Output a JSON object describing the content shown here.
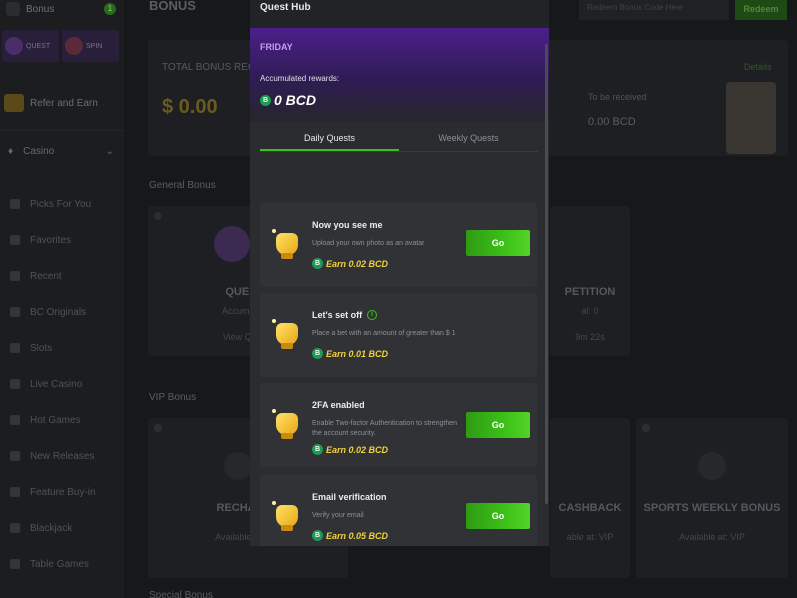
{
  "sidebar": {
    "bonus_label": "Bonus",
    "bonus_count": "1",
    "chips": [
      {
        "label": "QUEST"
      },
      {
        "label": "SPIN"
      }
    ],
    "refer_label": "Refer and Earn",
    "casino_label": "Casino",
    "items": [
      {
        "label": "Picks For You"
      },
      {
        "label": "Favorites"
      },
      {
        "label": "Recent"
      },
      {
        "label": "BC Originals"
      },
      {
        "label": "Slots"
      },
      {
        "label": "Live Casino"
      },
      {
        "label": "Hot Games"
      },
      {
        "label": "New Releases"
      },
      {
        "label": "Feature Buy-in"
      },
      {
        "label": "Blackjack"
      },
      {
        "label": "Table Games"
      }
    ]
  },
  "background": {
    "page_title": "BONUS",
    "search_placeholder": "Redeem Bonus Code Here",
    "redeem_label": "Redeem",
    "total_bonus_label": "TOTAL BONUS RECEIV",
    "total_bonus_value": "$ 0.00",
    "details_label": "Details",
    "to_be_received_label": "To be received",
    "to_be_received_value": "0.00 BCD",
    "general_bonus_label": "General Bonus",
    "quests_card": {
      "title": "QUESTS",
      "accum": "Accumulated",
      "value": "0 BC",
      "link": "View Quests"
    },
    "competition_card": {
      "title": "PETITION",
      "sub": "al: 0",
      "time": "9m 22s"
    },
    "vip_bonus_label": "VIP Bonus",
    "recharge_card": {
      "title": "RECHARGE",
      "avail": "Available at: VIP"
    },
    "cashback_card": {
      "title": "CASHBACK",
      "avail": "able at: VIP"
    },
    "sports_card": {
      "title": "SPORTS WEEKLY BONUS",
      "avail": "Available at: VIP"
    },
    "special_bonus_label": "Special Bonus"
  },
  "modal": {
    "title": "Quest Hub",
    "day": "FRIDAY",
    "accumulated_label": "Accumulated rewards:",
    "accumulated_value": "0 BCD",
    "coin_symbol": "B",
    "tabs": [
      {
        "label": "Daily Quests",
        "active": true
      },
      {
        "label": "Weekly Quests",
        "active": false
      }
    ],
    "quests": [
      {
        "title": "Now you see me",
        "desc": "Upload your own photo as an avatar",
        "earn": "Earn 0.02 BCD",
        "button": "Go"
      },
      {
        "title": "Let's set off",
        "desc": "Place a bet with an amount of greater than $ 1",
        "earn": "Earn 0.01 BCD",
        "button": ""
      },
      {
        "title": "2FA enabled",
        "desc": "Enable Two-factor Authentication to strengthen the account security.",
        "earn": "Earn 0.02 BCD",
        "button": "Go"
      },
      {
        "title": "Email verification",
        "desc": "Verify your email",
        "earn": "Earn 0.05 BCD",
        "button": "Go"
      }
    ],
    "colors": {
      "accent": "#3bc117",
      "earn": "#f4d23a",
      "banner": "#4b1f8a"
    }
  }
}
